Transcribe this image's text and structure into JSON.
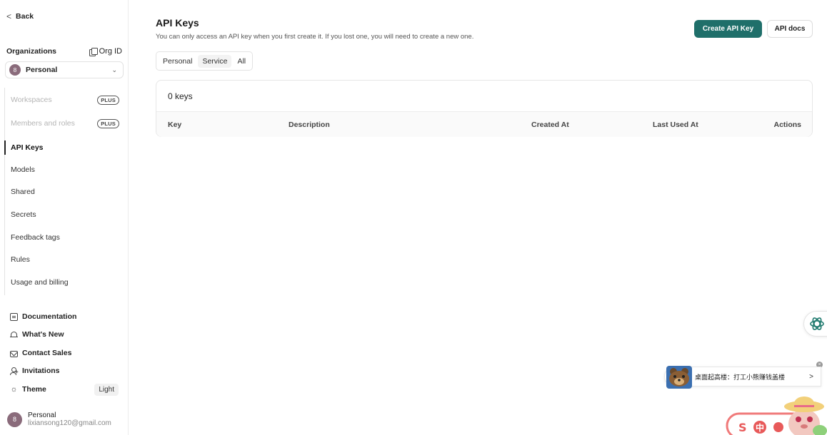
{
  "sidebar": {
    "back_label": "Back",
    "org_title": "Organizations",
    "org_id_label": "Org ID",
    "org_select": {
      "avatar_letter": "8",
      "value": "Personal"
    },
    "nav": [
      {
        "label": "Workspaces",
        "badge": "PLUS",
        "disabled": true
      },
      {
        "label": "Members and roles",
        "badge": "PLUS",
        "disabled": true
      },
      {
        "label": "API Keys",
        "active": true
      },
      {
        "label": "Models"
      },
      {
        "label": "Shared"
      },
      {
        "label": "Secrets"
      },
      {
        "label": "Feedback tags"
      },
      {
        "label": "Rules"
      },
      {
        "label": "Usage and billing"
      }
    ],
    "links": [
      {
        "label": "Documentation",
        "icon": "document-icon"
      },
      {
        "label": "What's New",
        "icon": "bell-icon"
      },
      {
        "label": "Contact Sales",
        "icon": "mail-icon"
      },
      {
        "label": "Invitations",
        "icon": "user-plus-icon"
      },
      {
        "label": "Theme",
        "icon": "sun-icon",
        "value": "Light"
      }
    ],
    "profile": {
      "avatar_letter": "8",
      "name": "Personal",
      "email": "lixiansong120@gmail.com"
    }
  },
  "main": {
    "title": "API Keys",
    "subtitle": "You can only access an API key when you first create it. If you lost one, you will need to create a new one.",
    "create_button": "Create API Key",
    "docs_button": "API docs",
    "tabs": [
      {
        "label": "Personal"
      },
      {
        "label": "Service",
        "active": true
      },
      {
        "label": "All"
      }
    ],
    "key_count": "0 keys",
    "columns": [
      "Key",
      "Description",
      "Created At",
      "Last Used At",
      "Actions"
    ]
  },
  "overlay": {
    "toast_text": "桌面起高楼：打工小熊赚钱盖楼",
    "mascot_text": "中"
  },
  "colors": {
    "accent": "#1f6f6a",
    "avatar": "#8a6b7b"
  }
}
